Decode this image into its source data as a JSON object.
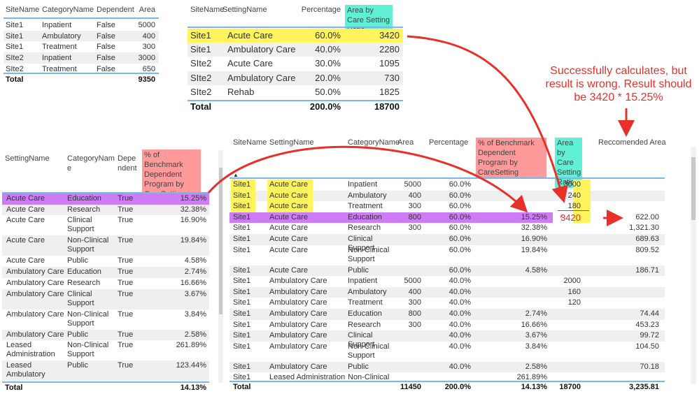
{
  "table1": {
    "headers": [
      "SiteName",
      "CategoryName",
      "Dependent",
      "Area"
    ],
    "rows": [
      [
        "Site1",
        "Inpatient",
        "False",
        "5000"
      ],
      [
        "Site1",
        "Ambulatory",
        "False",
        "400"
      ],
      [
        "Site1",
        "Treatment",
        "False",
        "300"
      ],
      [
        "SIte2",
        "Inpatient",
        "False",
        "3000"
      ],
      [
        "SIte2",
        "Treatment",
        "False",
        "650"
      ]
    ],
    "total": {
      "label": "Total",
      "area": "9350"
    }
  },
  "table2": {
    "headers": [
      "SiteName",
      "SettingName",
      "Percentage",
      "Area by Care Setting Ratio"
    ],
    "rows": [
      [
        "Site1",
        "Acute Care",
        "60.0%",
        "3420"
      ],
      [
        "Site1",
        "Ambulatory Care",
        "40.0%",
        "2280"
      ],
      [
        "SIte2",
        "Acute Care",
        "30.0%",
        "1095"
      ],
      [
        "SIte2",
        "Ambulatory Care",
        "20.0%",
        "730"
      ],
      [
        "SIte2",
        "Rehab",
        "50.0%",
        "1825"
      ]
    ],
    "total": {
      "label": "Total",
      "percentage": "200.0%",
      "area": "18700"
    }
  },
  "table3": {
    "headers": [
      "SettingName",
      "CategoryNam e",
      "Depe ndent",
      "% of Benchmark Dependent Program by CareSetting"
    ],
    "rows": [
      [
        "Acute Care",
        "Education",
        "True",
        "15.25%"
      ],
      [
        "Acute Care",
        "Research",
        "True",
        "32.38%"
      ],
      [
        "Acute Care",
        "Clinical Support",
        "True",
        "16.90%"
      ],
      [
        "Acute Care",
        "Non-Clinical Support",
        "True",
        "19.84%"
      ],
      [
        "Acute Care",
        "Public",
        "True",
        "4.58%"
      ],
      [
        "Ambulatory Care",
        "Education",
        "True",
        "2.74%"
      ],
      [
        "Ambulatory Care",
        "Research",
        "True",
        "16.66%"
      ],
      [
        "Ambulatory Care",
        "Clinical Support",
        "True",
        "3.67%"
      ],
      [
        "Ambulatory Care",
        "Non-Clinical Support",
        "True",
        "3.84%"
      ],
      [
        "Ambulatory Care",
        "Public",
        "True",
        "2.58%"
      ],
      [
        "Leased Administration",
        "Non-Clinical Support",
        "True",
        "261.89%"
      ],
      [
        "Leased Ambulatory",
        "Public",
        "True",
        "123.44%"
      ]
    ],
    "total": {
      "label": "Total",
      "value": "14.13%"
    }
  },
  "table4": {
    "headers": [
      "SiteName",
      "SettingName",
      "CategoryName",
      "Area",
      "Percentage",
      "% of Benchmark Dependent Program by CareSetting",
      "Area by Care Setting Ratio",
      "Reccomended Area"
    ],
    "rows": [
      [
        "Site1",
        "Acute Care",
        "Inpatient",
        "5000",
        "60.0%",
        "",
        "3000",
        ""
      ],
      [
        "Site1",
        "Acute Care",
        "Ambulatory",
        "400",
        "60.0%",
        "",
        "240",
        ""
      ],
      [
        "Site1",
        "Acute Care",
        "Treatment",
        "300",
        "60.0%",
        "",
        "180",
        ""
      ],
      [
        "Site1",
        "Acute Care",
        "Education",
        "800",
        "60.0%",
        "15.25%",
        "3420",
        "622.00"
      ],
      [
        "Site1",
        "Acute Care",
        "Research",
        "300",
        "60.0%",
        "32.38%",
        "",
        "1,321.30"
      ],
      [
        "Site1",
        "Acute Care",
        "Clinical Support",
        "",
        "60.0%",
        "16.90%",
        "",
        "689.63"
      ],
      [
        "Site1",
        "Acute Care",
        "Non-Clinical Support",
        "",
        "60.0%",
        "19.84%",
        "",
        "809.52"
      ],
      [
        "Site1",
        "Acute Care",
        "Public",
        "",
        "60.0%",
        "4.58%",
        "",
        "186.71"
      ],
      [
        "Site1",
        "Ambulatory Care",
        "Inpatient",
        "5000",
        "40.0%",
        "",
        "2000",
        ""
      ],
      [
        "Site1",
        "Ambulatory Care",
        "Ambulatory",
        "400",
        "40.0%",
        "",
        "160",
        ""
      ],
      [
        "Site1",
        "Ambulatory Care",
        "Treatment",
        "300",
        "40.0%",
        "",
        "120",
        ""
      ],
      [
        "Site1",
        "Ambulatory Care",
        "Education",
        "800",
        "40.0%",
        "2.74%",
        "",
        "74.44"
      ],
      [
        "Site1",
        "Ambulatory Care",
        "Research",
        "300",
        "40.0%",
        "16.66%",
        "",
        "453.23"
      ],
      [
        "Site1",
        "Ambulatory Care",
        "Clinical Support",
        "",
        "40.0%",
        "3.67%",
        "",
        "99.72"
      ],
      [
        "Site1",
        "Ambulatory Care",
        "Non-Clinical Support",
        "",
        "40.0%",
        "3.84%",
        "",
        "104.50"
      ],
      [
        "Site1",
        "Ambulatory Care",
        "Public",
        "",
        "40.0%",
        "2.58%",
        "",
        "70.18"
      ],
      [
        "Site1",
        "Leased Administration",
        "Non-Clinical",
        "",
        "",
        "261.89%",
        "",
        ""
      ]
    ],
    "total": {
      "label": "Total",
      "area": "11450",
      "percentage": "200.0%",
      "benchmark": "14.13%",
      "ratio": "18700",
      "recommended": "3,235.81"
    }
  },
  "annotation": {
    "text": "Successfully calculates, but result is wrong. Result should be 3420 * 15.25%",
    "multiply": "*"
  },
  "colors": {
    "highlight_yellow": "#fff45c",
    "highlight_purple": "#cd7cf5",
    "header_pink": "#ff9a9a",
    "header_teal": "#5ff0d6",
    "annotation_red": "#e8302a",
    "divider_blue": "#7ab8ec"
  }
}
